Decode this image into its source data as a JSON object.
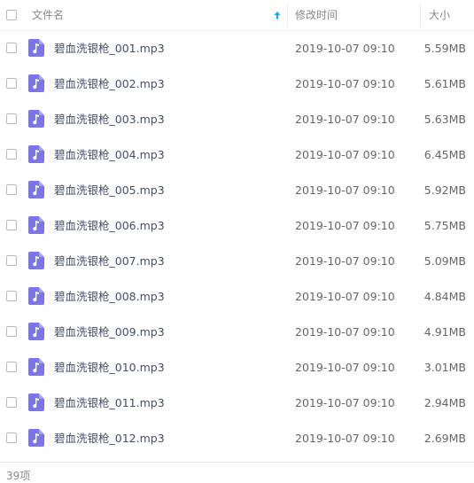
{
  "header": {
    "name_label": "文件名",
    "date_label": "修改时间",
    "size_label": "大小"
  },
  "files": [
    {
      "name": "碧血洗银枪_001.mp3",
      "modified": "2019-10-07 09:10",
      "size": "5.59MB"
    },
    {
      "name": "碧血洗银枪_002.mp3",
      "modified": "2019-10-07 09:10",
      "size": "5.61MB"
    },
    {
      "name": "碧血洗银枪_003.mp3",
      "modified": "2019-10-07 09:10",
      "size": "5.63MB"
    },
    {
      "name": "碧血洗银枪_004.mp3",
      "modified": "2019-10-07 09:10",
      "size": "6.45MB"
    },
    {
      "name": "碧血洗银枪_005.mp3",
      "modified": "2019-10-07 09:10",
      "size": "5.92MB"
    },
    {
      "name": "碧血洗银枪_006.mp3",
      "modified": "2019-10-07 09:10",
      "size": "5.75MB"
    },
    {
      "name": "碧血洗银枪_007.mp3",
      "modified": "2019-10-07 09:10",
      "size": "5.09MB"
    },
    {
      "name": "碧血洗银枪_008.mp3",
      "modified": "2019-10-07 09:10",
      "size": "4.84MB"
    },
    {
      "name": "碧血洗银枪_009.mp3",
      "modified": "2019-10-07 09:10",
      "size": "4.91MB"
    },
    {
      "name": "碧血洗银枪_010.mp3",
      "modified": "2019-10-07 09:10",
      "size": "3.01MB"
    },
    {
      "name": "碧血洗银枪_011.mp3",
      "modified": "2019-10-07 09:10",
      "size": "2.94MB"
    },
    {
      "name": "碧血洗银枪_012.mp3",
      "modified": "2019-10-07 09:10",
      "size": "2.69MB"
    }
  ],
  "footer": {
    "count_label": "39项"
  },
  "icons": {
    "file_icon": "music-file-icon",
    "sort_icon": "sort-ascending-arrow-icon"
  },
  "colors": {
    "accent": "#09aaff",
    "music_icon": "#7b75e6",
    "text": "#424e67",
    "muted": "#888888"
  }
}
